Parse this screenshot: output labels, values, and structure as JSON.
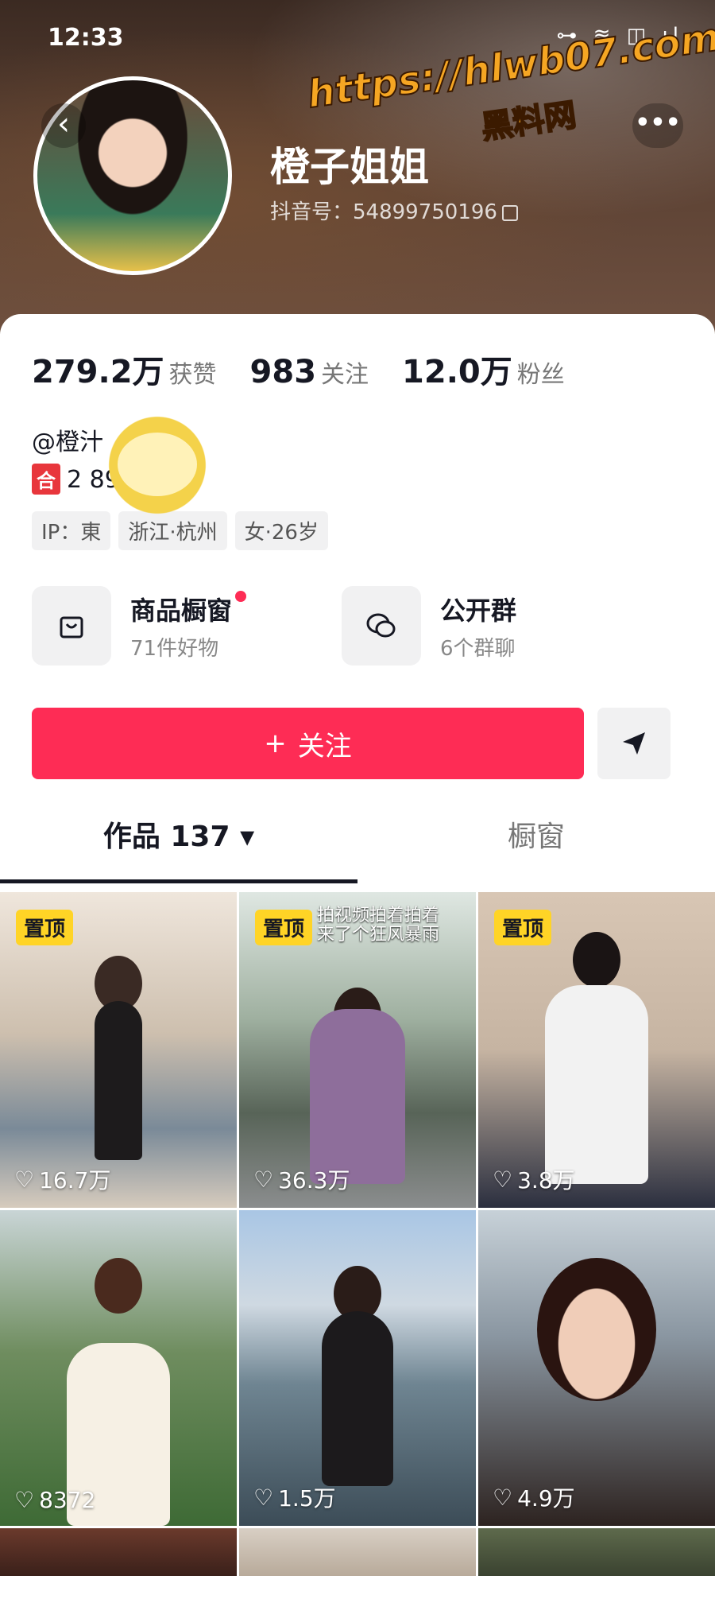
{
  "status_bar": {
    "time": "12:33",
    "icons": "⊶ ≋ ◫ ıl"
  },
  "watermark": {
    "url": "https://hlwb07.com",
    "name": "黑料网"
  },
  "profile": {
    "nickname": "橙子姐姐",
    "douyin_id": "抖音号：54899750196",
    "stats": [
      {
        "value": "279.2万",
        "label": "获赞"
      },
      {
        "value": "983",
        "label": "关注"
      },
      {
        "value": "12.0万",
        "label": "粉丝"
      }
    ],
    "handle": "@橙汁",
    "region_tag": "合",
    "region_text": "2    89",
    "tags": [
      "IP：東",
      "浙江·杭州",
      "女·26岁"
    ]
  },
  "features": [
    {
      "title": "商品橱窗",
      "subtitle": "71件好物",
      "icon": "shopping-bag-icon"
    },
    {
      "title": "公开群",
      "subtitle": "6个群聊",
      "icon": "chat-bubbles-icon"
    }
  ],
  "actions": {
    "follow_label": "关注",
    "follow_icon": "+",
    "share_icon": "➤"
  },
  "tabs": {
    "works": "作品 137",
    "showcase": "橱窗"
  },
  "videos": [
    {
      "pinned": "置顶",
      "likes": "16.7万"
    },
    {
      "pinned": "置顶",
      "likes": "36.3万",
      "caption_1": "拍视频拍着拍着",
      "caption_2": "来了个狂风暴雨"
    },
    {
      "pinned": "置顶",
      "likes": "3.8万"
    },
    {
      "likes": "8372"
    },
    {
      "likes": "1.5万"
    },
    {
      "likes": "4.9万"
    }
  ],
  "colors": {
    "accent": "#fe2c55",
    "pin": "#ffd426"
  }
}
